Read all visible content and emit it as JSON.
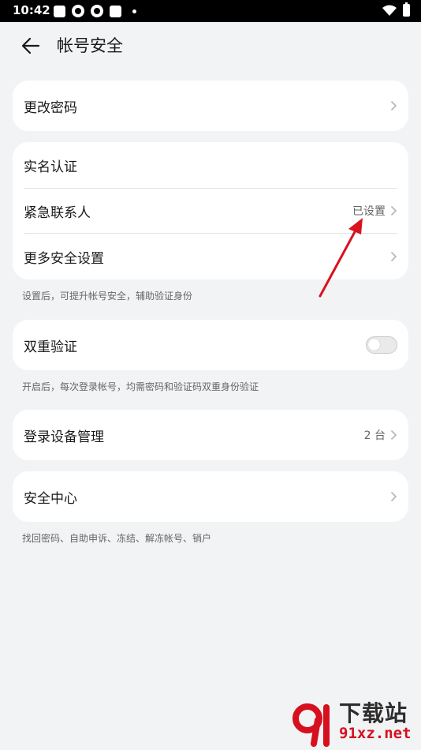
{
  "status_bar": {
    "time": "10:42"
  },
  "header": {
    "title": "帐号安全"
  },
  "sections": {
    "change_password": {
      "label": "更改密码"
    },
    "identity": {
      "real_name": {
        "label": "实名认证"
      },
      "emergency_contact": {
        "label": "紧急联系人",
        "value": "已设置"
      },
      "more_security": {
        "label": "更多安全设置"
      },
      "hint": "设置后，可提升帐号安全，辅助验证身份"
    },
    "two_factor": {
      "label": "双重验证",
      "enabled": false,
      "hint": "开启后，每次登录帐号，均需密码和验证码双重身份验证"
    },
    "devices": {
      "label": "登录设备管理",
      "value": "2 台"
    },
    "security_center": {
      "label": "安全中心",
      "hint": "找回密码、自助申诉、冻结、解冻帐号、销户"
    }
  },
  "watermark": {
    "name": "下载站",
    "url": "91xz.net"
  },
  "colors": {
    "background": "#f1f3f5",
    "card": "#ffffff",
    "annotation_arrow": "#d9121f"
  }
}
